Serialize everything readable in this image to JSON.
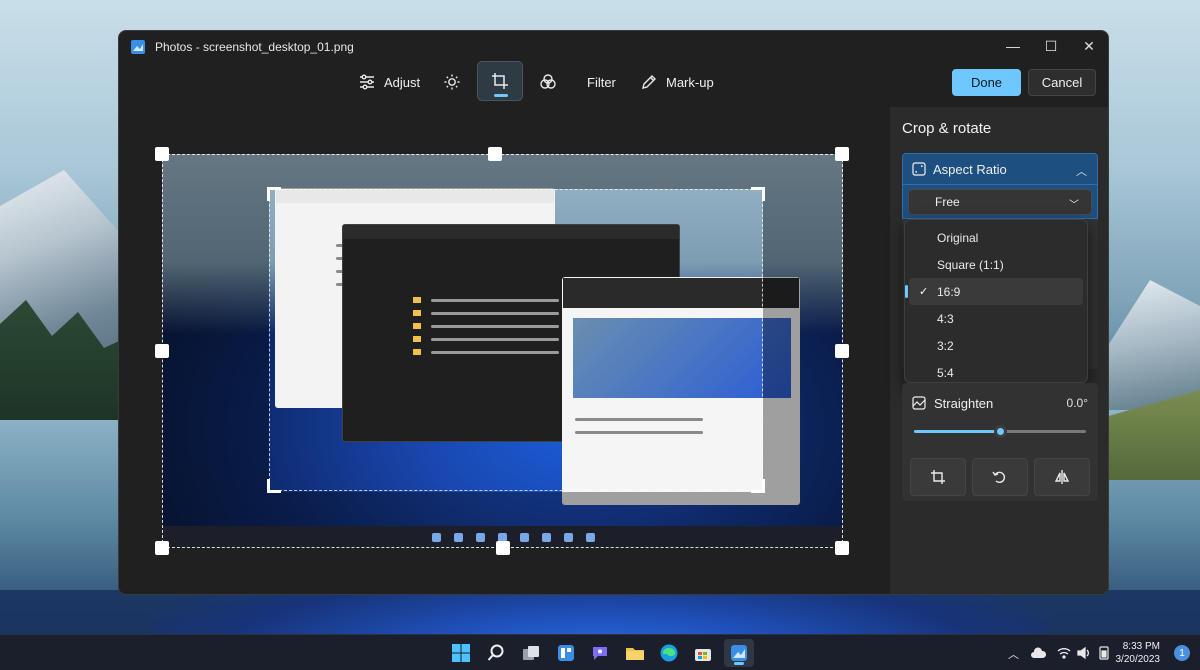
{
  "window": {
    "title": "Photos - screenshot_desktop_01.png",
    "minimize_glyph": "—",
    "maximize_glyph": "☐",
    "close_glyph": "✕"
  },
  "toolbar": {
    "adjust_label": "Adjust",
    "filter_label": "Filter",
    "markup_label": "Mark-up",
    "done_label": "Done",
    "cancel_label": "Cancel"
  },
  "panel": {
    "title": "Crop & rotate",
    "aspect_ratio_label": "Aspect Ratio",
    "aspect_ratio_selected": "Free",
    "options": [
      "Original",
      "Square (1:1)",
      "16:9",
      "4:3",
      "3:2",
      "5:4"
    ],
    "selected_option": "16:9",
    "straighten_label": "Straighten",
    "straighten_value": "0.0°",
    "straighten_fraction": 0.5
  },
  "taskbar": {
    "time": "8:33 PM",
    "date": "3/20/2023",
    "notifications": "1"
  },
  "colors": {
    "accent": "#6ec7ff",
    "window_bg": "#202020",
    "panel_bg": "#2b2b2b",
    "aspect_header": "#1d4f80"
  }
}
